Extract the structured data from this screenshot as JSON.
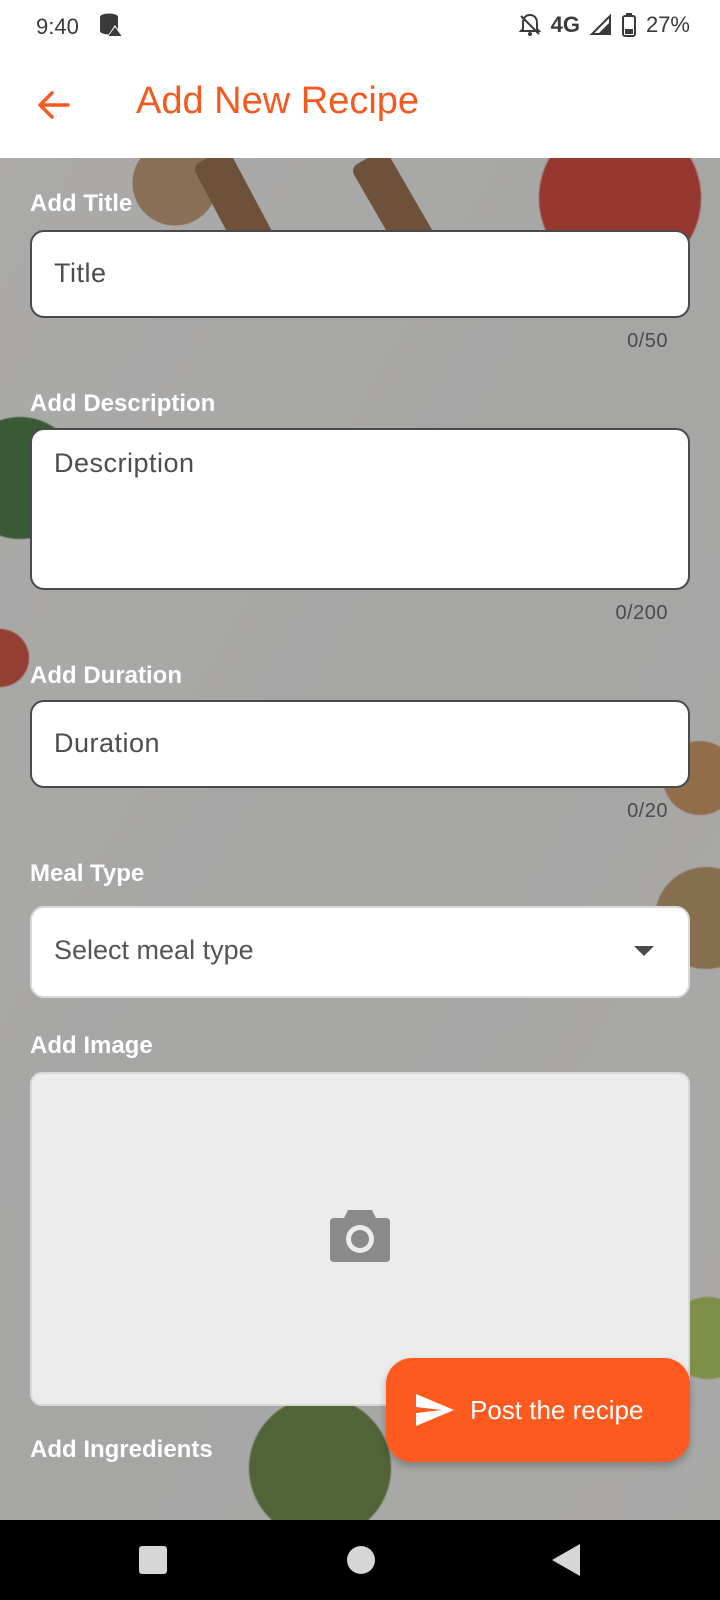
{
  "status_bar": {
    "time": "9:40",
    "network": "4G",
    "battery": "27%"
  },
  "app_bar": {
    "title": "Add New Recipe",
    "accent_color": "#f45a1f"
  },
  "form": {
    "title": {
      "label": "Add Title",
      "placeholder": "Title",
      "counter": "0/50"
    },
    "description": {
      "label": "Add Description",
      "placeholder": "Description",
      "counter": "0/200"
    },
    "duration": {
      "label": "Add Duration",
      "placeholder": "Duration",
      "counter": "0/20"
    },
    "meal_type": {
      "label": "Meal Type",
      "value": "Select meal type"
    },
    "image": {
      "label": "Add Image"
    },
    "ingredients": {
      "label": "Add Ingredients"
    }
  },
  "fab": {
    "label": "Post the recipe",
    "color": "#fd5a20",
    "icon": "send-icon"
  }
}
